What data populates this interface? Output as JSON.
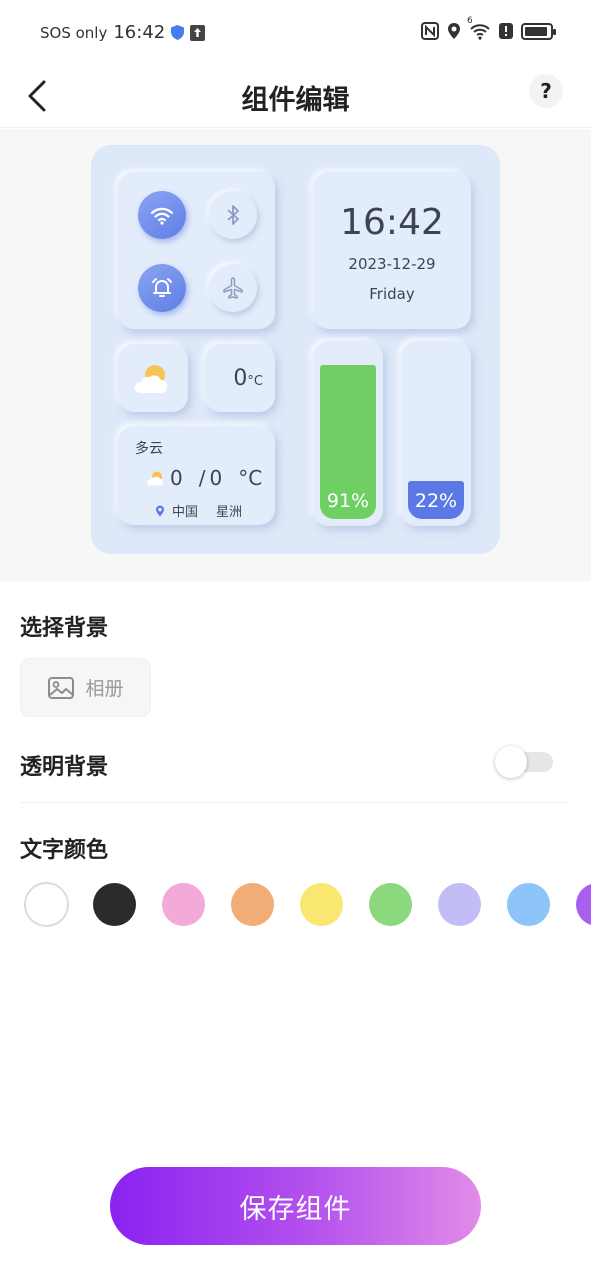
{
  "status_bar": {
    "carrier_text": "SOS only",
    "time": "16:42",
    "wifi_badge": "6",
    "battery_level": 0.9,
    "icons": [
      "shield-icon",
      "upload-icon",
      "nfc-icon",
      "location-icon",
      "wifi-icon",
      "alert-icon",
      "battery-icon"
    ]
  },
  "header": {
    "title": "组件编辑",
    "back_icon": "chevron-left-icon",
    "help_label": "?"
  },
  "preview": {
    "toggles": [
      {
        "icon": "wifi-icon",
        "on": true
      },
      {
        "icon": "bluetooth-icon",
        "on": false
      },
      {
        "icon": "alarm-icon",
        "on": true
      },
      {
        "icon": "airplane-icon",
        "on": false
      }
    ],
    "clock": {
      "time": "16:42",
      "date": "2023-12-29",
      "day": "Friday"
    },
    "weather_small": {
      "icon": "partly-cloudy-icon",
      "temp": "0",
      "unit": "°C"
    },
    "weather_card": {
      "condition": "多云",
      "low": "0",
      "high": "0",
      "separator": "/",
      "unit": "°C",
      "country": "中国",
      "city": "星洲"
    },
    "bars": [
      {
        "label": "91%",
        "level": 0.91,
        "color": "#6fcf65"
      },
      {
        "label": "22%",
        "level": 0.22,
        "color": "#5b79e4"
      }
    ]
  },
  "background": {
    "title": "选择背景",
    "album_label": "相册",
    "album_icon": "image-icon"
  },
  "transparent": {
    "title": "透明背景",
    "enabled": false
  },
  "text_color": {
    "title": "文字颜色",
    "swatches": [
      "#ffffff",
      "#2b2b2b",
      "#f4aad8",
      "#f2ad77",
      "#f9e772",
      "#8cd97d",
      "#c3bdf6",
      "#8dc4f9",
      "#a95ef0"
    ],
    "selected_index": 0
  },
  "save_button": {
    "label": "保存组件"
  },
  "colors": {
    "accent_gradient_start": "#8a22f0",
    "accent_gradient_end": "#e08ce8",
    "widget_bg": "#dde8f9"
  }
}
